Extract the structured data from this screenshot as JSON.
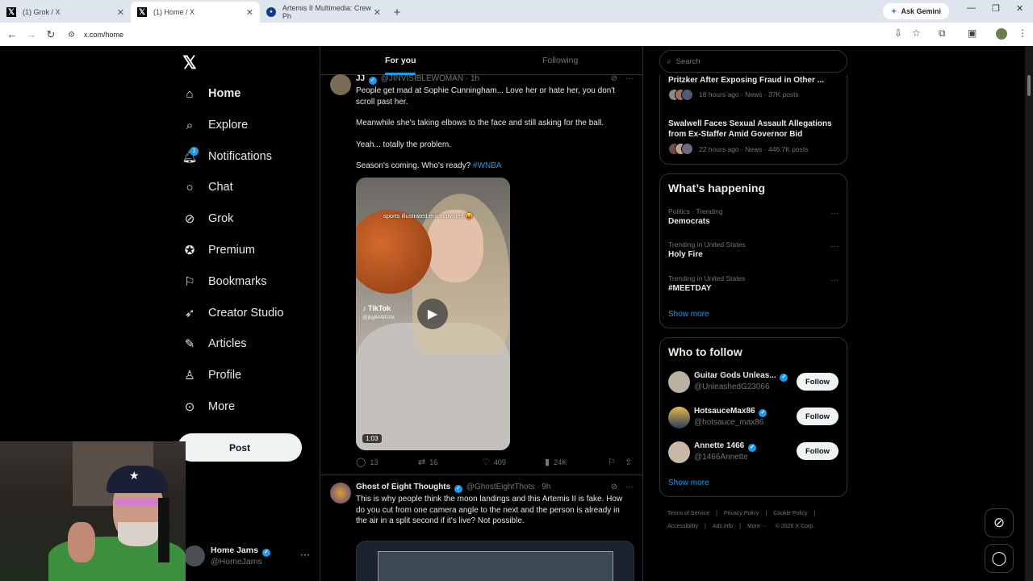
{
  "browser": {
    "tabs": [
      {
        "title": "(1) Grok / X",
        "icon": "x-logo-icon"
      },
      {
        "title": "(1) Home / X",
        "icon": "x-logo-icon"
      },
      {
        "title": "Artemis II Multimedia: Crew Ph",
        "icon": "nasa-icon"
      }
    ],
    "ask_gemini": "Ask Gemini",
    "url": "x.com/home"
  },
  "sidebar": {
    "logo": "𝕏",
    "nav": [
      {
        "label": "Home",
        "icon": "home-icon"
      },
      {
        "label": "Explore",
        "icon": "search-icon"
      },
      {
        "label": "Notifications",
        "icon": "bell-icon",
        "badge": "1"
      },
      {
        "label": "Chat",
        "icon": "chat-icon"
      },
      {
        "label": "Grok",
        "icon": "grok-icon"
      },
      {
        "label": "Premium",
        "icon": "verified-icon"
      },
      {
        "label": "Bookmarks",
        "icon": "bookmark-icon"
      },
      {
        "label": "Creator Studio",
        "icon": "rocket-icon"
      },
      {
        "label": "Articles",
        "icon": "article-icon"
      },
      {
        "label": "Profile",
        "icon": "person-icon"
      },
      {
        "label": "More",
        "icon": "more-circle-icon"
      }
    ],
    "post_button": "Post",
    "account": {
      "name": "Home Jams",
      "handle": "@HomeJams"
    }
  },
  "timeline": {
    "tabs": [
      "For you",
      "Following"
    ],
    "posts": [
      {
        "name": "JJ",
        "handle": "@JINVISIBLEWOMAN",
        "time": "· 1h",
        "paragraphs": [
          "People get mad at Sophie Cunningham... Love her or hate her, you don't scroll past her.",
          "Meanwhile she's taking elbows to the face and still asking for the ball.",
          "Yeah... totally the problem.",
          "Season's coming. Who's ready?"
        ],
        "hashtag": "#WNBA",
        "video": {
          "caption": "sports illustrated era activated 😝",
          "watermark": "TikTok",
          "watermark_user": "@jkg84482/la",
          "duration": "1:03"
        },
        "stats": {
          "replies": "13",
          "reposts": "16",
          "likes": "409",
          "views": "24K"
        }
      },
      {
        "name": "Ghost of Eight Thoughts",
        "handle": "@GhostEightThots",
        "time": "· 9h",
        "text": "This is why people think the moon landings and this Artemis II is fake. How do you cut from one camera angle to the next and the person is already in the air in a split second if it's live? Not possible."
      }
    ]
  },
  "right": {
    "search_placeholder": "Search",
    "news": [
      {
        "title": "Pritzker After Exposing Fraud in Other ...",
        "meta": "18 hours ago · News · 37K posts"
      },
      {
        "title": "Swalwell Faces Sexual Assault Allegations from Ex-Staffer Amid Governor Bid",
        "meta": "22 hours ago · News · 446.7K posts"
      }
    ],
    "happening": {
      "title": "What’s happening",
      "items": [
        {
          "context": "Politics · Trending",
          "topic": "Democrats"
        },
        {
          "context": "Trending in United States",
          "topic": "Holy Fire"
        },
        {
          "context": "Trending in United States",
          "topic": "#MEETDAY"
        }
      ],
      "show_more": "Show more"
    },
    "who_to_follow": {
      "title": "Who to follow",
      "users": [
        {
          "name": "Guitar Gods Unleas...",
          "handle": "@UnleashedG23066",
          "button": "Follow"
        },
        {
          "name": "HotsauceMax86",
          "handle": "@hotsauce_max86",
          "button": "Follow"
        },
        {
          "name": "Annette 1466",
          "handle": "@1466Annette",
          "button": "Follow"
        }
      ],
      "show_more": "Show more"
    },
    "footer": {
      "links": [
        "Terms of Service",
        "Privacy Policy",
        "Cookie Policy",
        "Accessibility",
        "Ads info",
        "More ···"
      ],
      "copyright": "© 2026 X Corp."
    }
  }
}
